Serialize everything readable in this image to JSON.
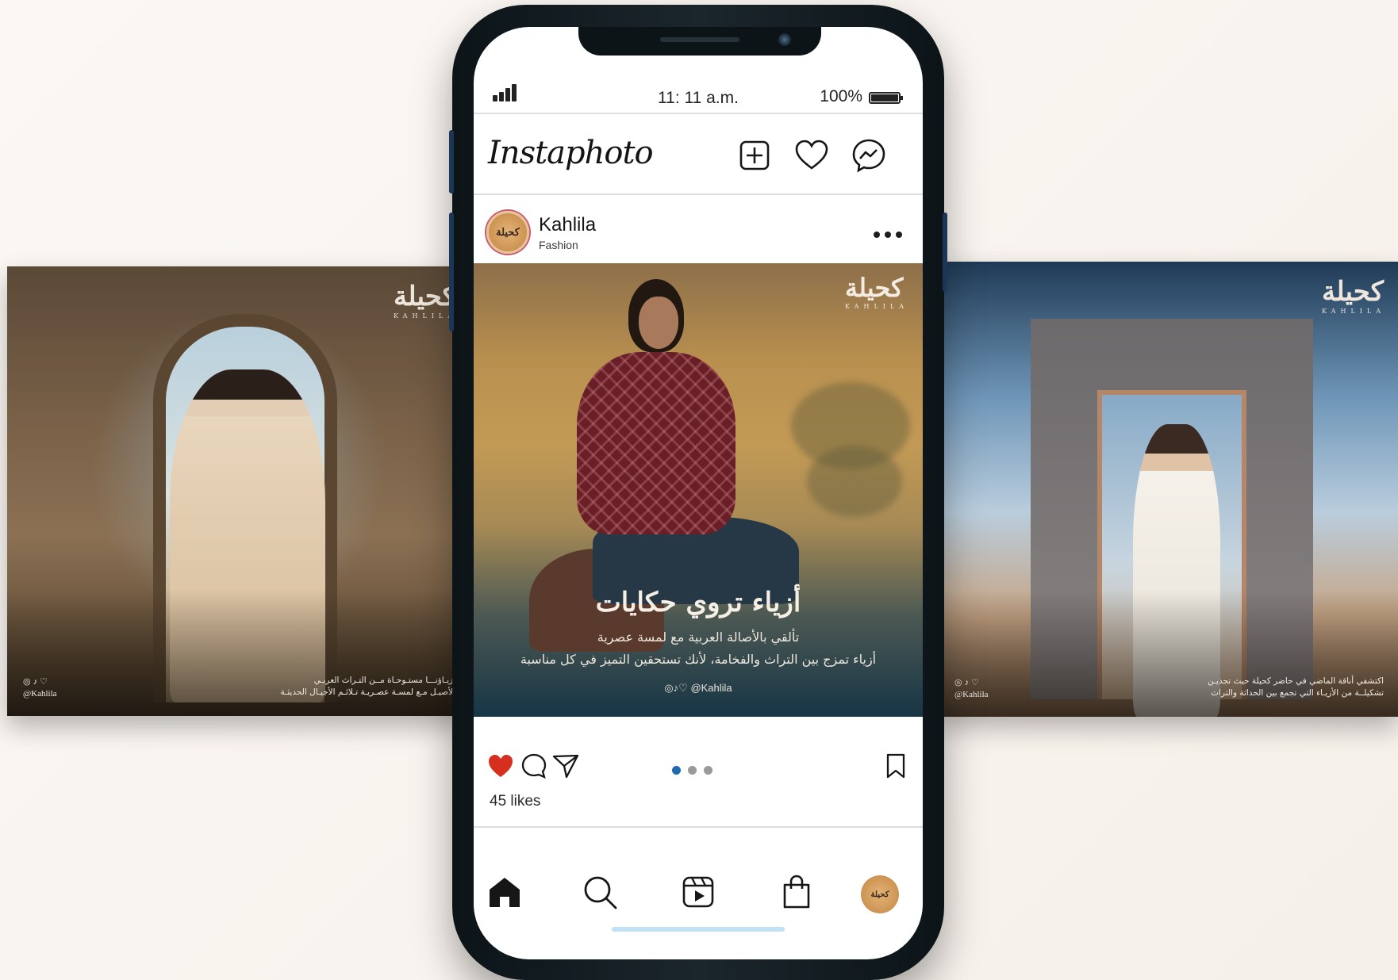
{
  "phone": {
    "status_bar": {
      "time": "11: 11 a.m.",
      "battery": "100%"
    },
    "app": {
      "name": "Instaphoto",
      "header_icons": [
        "add-post-icon",
        "heart-icon",
        "messenger-icon"
      ]
    },
    "post": {
      "account_name": "Kahlila",
      "account_subtitle": "Fashion",
      "avatar_logo": "كحيلة",
      "image": {
        "logo": "كحيلة",
        "logo_tag": "KAHLILA",
        "headline": "أزياء تروي حكايات",
        "line1": "تألقي بالأصالة العربية مع لمسة عصرية",
        "line2": "أزياء تمزج بين التراث والفخامة، لأنك تستحقين التميز في كل مناسبة",
        "social_icons": "◎♪♡",
        "handle": "@Kahlila"
      },
      "likes": "45 likes",
      "liked": true,
      "carousel_total": 3,
      "carousel_active": 1
    },
    "bottom_nav": [
      "home-icon",
      "search-icon",
      "reels-icon",
      "shop-icon",
      "profile-avatar"
    ]
  },
  "poster_left": {
    "logo": "كحيلة",
    "logo_tag": "KAHLILA",
    "social_icons": "◎♪♡",
    "handle": "@Kahlila",
    "caption_line1": "أزيـاؤنـــا مستـوحـاة مــن التـراث العربـي",
    "caption_line2": "الأصيـل مـع لمسـة عصـريـة تـلائـم الأجيـال الحديثـة"
  },
  "poster_right": {
    "logo": "كحيلة",
    "logo_tag": "KAHLILA",
    "social_icons": "◎♪♡",
    "handle": "@Kahlila",
    "caption_line1": "اكتشفي أناقة الماضي في حاضر كحيلة حيث تجديـن",
    "caption_line2": "تشكيلــة من الأزيـاء التي تجمع بين الحداثة والتراث"
  },
  "colors": {
    "like_red": "#d62e1f",
    "pager_active": "#1d6bb3",
    "phone_body": "#0c1418"
  }
}
